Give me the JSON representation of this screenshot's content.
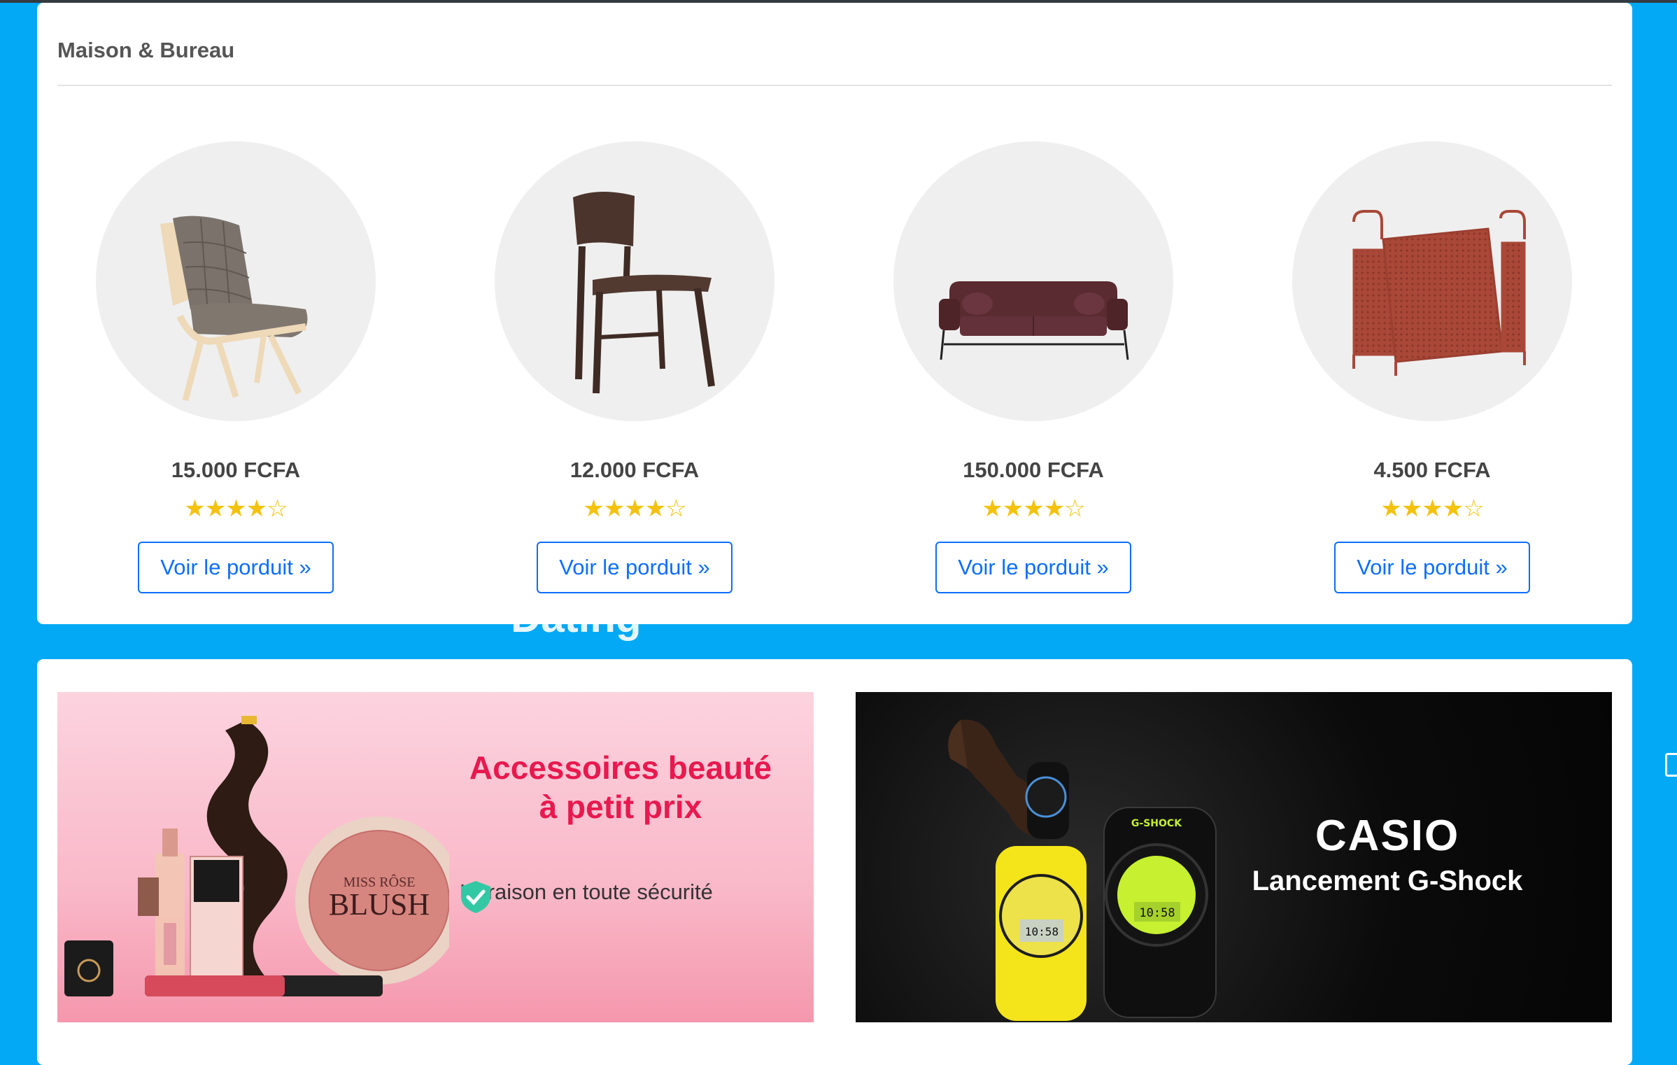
{
  "section": {
    "title": "Maison & Bureau"
  },
  "products": [
    {
      "name": "armchair",
      "price": "15.000 FCFA",
      "rating": 4,
      "max_rating": 5,
      "stars": "★★★★☆",
      "button": "Voir le porduit »"
    },
    {
      "name": "wooden-chair",
      "price": "12.000 FCFA",
      "rating": 4,
      "max_rating": 5,
      "stars": "★★★★☆",
      "button": "Voir le porduit »"
    },
    {
      "name": "sofa",
      "price": "150.000 FCFA",
      "rating": 4,
      "max_rating": 5,
      "stars": "★★★★☆",
      "button": "Voir le porduit »"
    },
    {
      "name": "magazine-rack",
      "price": "4.500 FCFA",
      "rating": 4,
      "max_rating": 5,
      "stars": "★★★★☆",
      "button": "Voir le porduit »"
    }
  ],
  "banners": {
    "beauty": {
      "headline_1": "Accessoires beauté",
      "headline_2": "à petit prix",
      "subline": "Livraison en toute sécurité",
      "product_text_1": "MISS RÔSE",
      "product_text_2": "BLUSH",
      "accent_color": "#e8194f"
    },
    "casio": {
      "brand": "CASIO",
      "subline": "Lancement G-Shock",
      "watch_brand": "G-SHOCK",
      "watch_display": "10:58"
    }
  },
  "overlay_text": "Dating",
  "colors": {
    "page_bg": "#03a9f4",
    "button": "#0d6efd",
    "stars": "#f4c20d"
  }
}
